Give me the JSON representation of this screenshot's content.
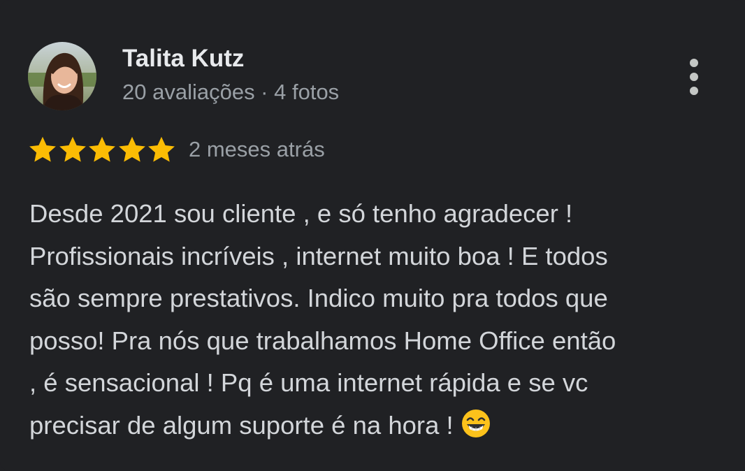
{
  "review": {
    "author_name": "Talita Kutz",
    "author_meta": "20 avaliações · 4 fotos",
    "rating": 5,
    "rating_max": 5,
    "time_ago": "2 meses atrás",
    "text_lines": [
      "Desde 2021 sou cliente , e só tenho agradecer !",
      "Profissionais incríveis , internet muito boa ! E todos",
      "são sempre prestativos. Indico muito pra todos que",
      "posso! Pra nós que trabalhamos Home Office então",
      ", é sensacional ! Pq é uma internet rápida e se vc",
      "precisar de algum suporte é na hora !"
    ],
    "emoji_icon": "grinning-face-with-smiling-eyes-icon",
    "menu_icon": "more-vert-icon"
  },
  "colors": {
    "background": "#202124",
    "name": "#e8eaed",
    "secondary_text": "#9aa0a6",
    "body_text": "#d3d6da",
    "star": "#fbbc04"
  }
}
